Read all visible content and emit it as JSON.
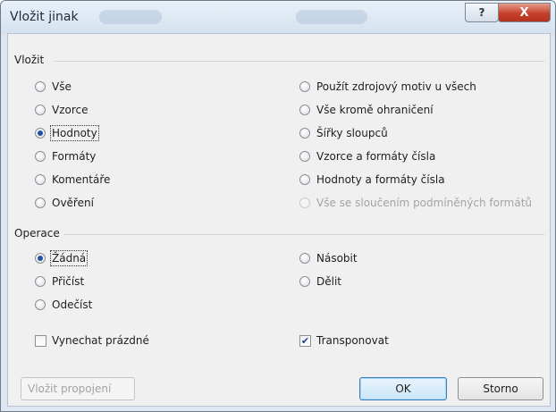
{
  "window": {
    "title": "Vložit jinak",
    "help_label": "?",
    "close_label": "X"
  },
  "paste_group": {
    "label": "Vložit",
    "left_options": [
      {
        "label": "Vše",
        "checked": false
      },
      {
        "label": "Vzorce",
        "checked": false
      },
      {
        "label": "Hodnoty",
        "checked": true
      },
      {
        "label": "Formáty",
        "checked": false
      },
      {
        "label": "Komentáře",
        "checked": false
      },
      {
        "label": "Ověření",
        "checked": false
      }
    ],
    "right_options": [
      {
        "label": "Použít zdrojový motiv u všech",
        "checked": false
      },
      {
        "label": "Vše kromě ohraničení",
        "checked": false
      },
      {
        "label": "Šířky sloupců",
        "checked": false
      },
      {
        "label": "Vzorce a formáty čísla",
        "checked": false
      },
      {
        "label": "Hodnoty a formáty čísla",
        "checked": false
      },
      {
        "label": "Vše se sloučením podmíněných formátů",
        "checked": false,
        "disabled": true
      }
    ]
  },
  "operation_group": {
    "label": "Operace",
    "left_options": [
      {
        "label": "Žádná",
        "checked": true
      },
      {
        "label": "Přičíst",
        "checked": false
      },
      {
        "label": "Odečíst",
        "checked": false
      }
    ],
    "right_options": [
      {
        "label": "Násobit",
        "checked": false
      },
      {
        "label": "Dělit",
        "checked": false
      }
    ]
  },
  "checkboxes": {
    "skip_blanks": {
      "label": "Vynechat prázdné",
      "checked": false
    },
    "transpose": {
      "label": "Transponovat",
      "checked": true
    }
  },
  "buttons": {
    "paste_link": "Vložit propojení",
    "ok": "OK",
    "cancel": "Storno"
  }
}
